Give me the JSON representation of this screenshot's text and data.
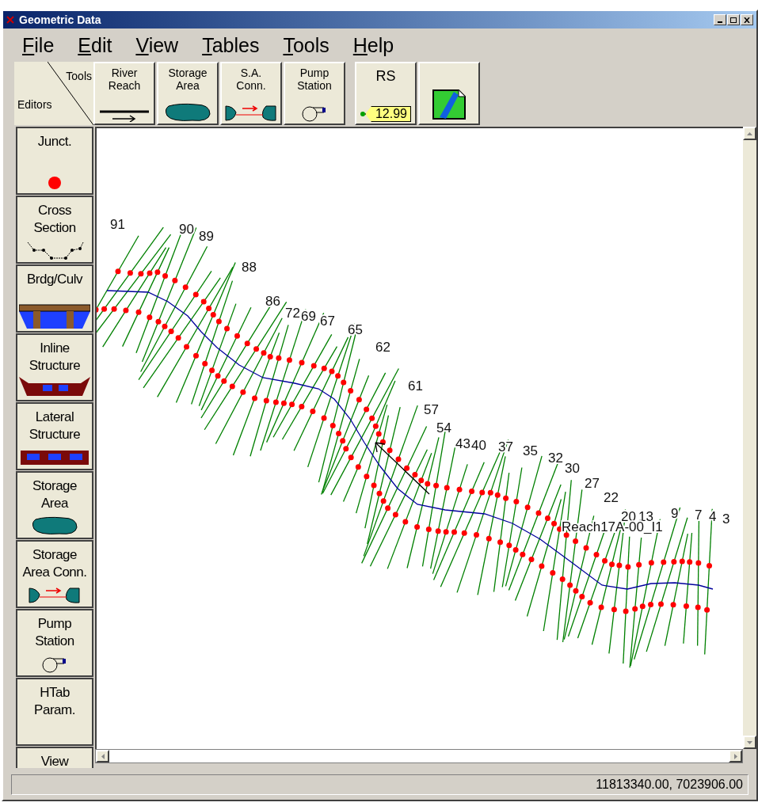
{
  "window": {
    "title": "Geometric Data"
  },
  "menu": [
    "File",
    "Edit",
    "View",
    "Tables",
    "Tools",
    "Help"
  ],
  "toolbar": {
    "corner": {
      "top": "Tools",
      "bottom": "Editors"
    },
    "tools": [
      {
        "kind": "reach",
        "lines": [
          "River",
          "Reach"
        ]
      },
      {
        "kind": "storage",
        "lines": [
          "Storage",
          "Area"
        ]
      },
      {
        "kind": "conn",
        "lines": [
          "S.A.",
          "Conn."
        ]
      },
      {
        "kind": "pump",
        "lines": [
          "Pump",
          "Station"
        ]
      },
      {
        "kind": "rs",
        "lines": [
          "RS"
        ],
        "tag": "12.99"
      },
      {
        "kind": "map"
      }
    ]
  },
  "editors": [
    {
      "kind": "junction",
      "lines": [
        "Junct."
      ]
    },
    {
      "kind": "xs",
      "lines": [
        "Cross",
        "Section"
      ]
    },
    {
      "kind": "bridge",
      "lines": [
        "Brdg/Culv"
      ]
    },
    {
      "kind": "inline",
      "lines": [
        "Inline",
        "Structure"
      ]
    },
    {
      "kind": "lateral",
      "lines": [
        "Lateral",
        "Structure"
      ]
    },
    {
      "kind": "storage",
      "lines": [
        "Storage",
        "Area"
      ]
    },
    {
      "kind": "conn",
      "lines": [
        "Storage",
        "Area Conn."
      ]
    },
    {
      "kind": "pump",
      "lines": [
        "Pump",
        "Station"
      ]
    },
    {
      "kind": "text",
      "lines": [
        "HTab",
        "Param."
      ]
    },
    {
      "kind": "text",
      "lines": [
        "View"
      ]
    }
  ],
  "map": {
    "stations": [
      {
        "label": "91"
      },
      {
        "label": "90"
      },
      {
        "label": "89"
      },
      {
        "label": "88"
      },
      {
        "label": "86"
      },
      {
        "label": "72"
      },
      {
        "label": "69"
      },
      {
        "label": "67"
      },
      {
        "label": "65"
      },
      {
        "label": "62"
      },
      {
        "label": "61"
      },
      {
        "label": "57"
      },
      {
        "label": "54"
      },
      {
        "label": "43"
      },
      {
        "label": "40"
      },
      {
        "label": "37"
      },
      {
        "label": "35"
      },
      {
        "label": "32"
      },
      {
        "label": "30"
      },
      {
        "label": "27"
      },
      {
        "label": "22"
      },
      {
        "label": "20"
      },
      {
        "label": "13"
      },
      {
        "label": "9"
      },
      {
        "label": "7"
      },
      {
        "label": "4"
      },
      {
        "label": "3"
      }
    ],
    "reach_label": "Reach17A-00_I1"
  },
  "status_bar": {
    "coordinates": "11813340.00, 7023906.00"
  }
}
